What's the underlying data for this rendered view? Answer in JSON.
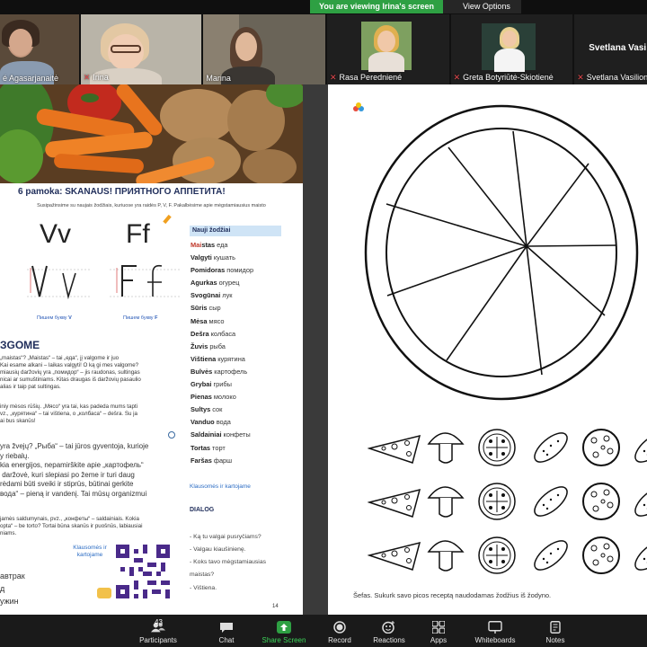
{
  "banner": {
    "viewing": "You are viewing Irina's screen",
    "view_options": "View Options"
  },
  "participants": [
    {
      "name": "é Agasarjanaitė",
      "muted": false
    },
    {
      "name": "Irina",
      "muted": true
    },
    {
      "name": "Marina",
      "muted": false
    },
    {
      "name": "Rasa Peredniené",
      "muted": true
    },
    {
      "name": "Greta Botyriūtė-Skiotienė",
      "muted": true
    },
    {
      "name": "Svetlana Vasilionoi",
      "muted": true
    }
  ],
  "big_name": "Svetlana Vasi",
  "left_page": {
    "title": "6 pamoka: SKANAUS! ПРИЯТНОГО АППЕТИТА!",
    "subtitle": "Susipažinsime su naujais žodžiais, kuriuose yra raidės P, V, F. Pakalbėsime apie mėgstamiausius maisto",
    "letter_v": "Vv",
    "letter_f": "Ff",
    "write_v_caption": "Пишем букву",
    "write_v_letter": "V",
    "write_f_caption": "Пишем букву",
    "write_f_letter": "F",
    "section_title": "ЗGOME",
    "para1": "„maistas“? „Maistas“ – tai „еда“, jį valgome ir juo\nKai esame alkani – laikas valgyti! O ką gi mes valgome?\nmiausių daržovių yra „помидор“ – jis raudonas, sultingas\nnicai ar sumuštiniams. Kitas draugas iš daržovių pasaulio\nalias ir taip pat sultingas.",
    "para2": "iniy mėsos rūšių. „Мясо“ yra tai, kas padeda mums tapti\nvz., „курятина“ – tai vištiena, o „колбаса“ – dešra. Su ja\nai bus skanūs!",
    "para3": "yra žvejų? „Рыба“ – tai jūros gyventoja, kurioje\ny riebalų.\nkia energijos, nepamirškite apie „картофель“\n daržovė, kuri slepiasi po žeme ir turi daug\nrėdami būti sveiki ir stiprūs, būtinai gerkite\nвода“ – pieną ir vandenį. Tai mūsų organizmui",
    "para4": "jamės saldumynais, pvz., „конфеты“ – saldainiais. Kokia\nopta“ – be torto? Tortai būna skanūs ir puošnūs, labiausiai\nniams.",
    "words_ru": [
      "автрак",
      "д",
      "ужин"
    ],
    "qr_label": "Klausomės ir kartojame",
    "page_number": "14",
    "vocab_header": "Nauji žodžiai",
    "vocab": [
      {
        "lt": "Mai",
        "lt2": "stas",
        "ru": "еда"
      },
      {
        "lt": "Val",
        "lt2": "gyti",
        "ru": "кушать"
      },
      {
        "lt": "Pom",
        "lt2": "idoras",
        "ru": "помидор"
      },
      {
        "lt": "Agu",
        "lt2": "rkas",
        "ru": "огурец"
      },
      {
        "lt": "Svo",
        "lt2": "gūnai",
        "ru": "лук"
      },
      {
        "lt": "Sū",
        "lt2": "ris",
        "ru": "сыр"
      },
      {
        "lt": "Mė",
        "lt2": "sa",
        "ru": "мясо"
      },
      {
        "lt": "De",
        "lt2": "šra",
        "ru": "колбаса"
      },
      {
        "lt": "Žu",
        "lt2": "vis",
        "ru": "рыба"
      },
      {
        "lt": "Viš",
        "lt2": "tiena",
        "ru": "курятина"
      },
      {
        "lt": "Bul",
        "lt2": "vės",
        "ru": "картофель"
      },
      {
        "lt": "Gry",
        "lt2": "bai",
        "ru": "грибы"
      },
      {
        "lt": "Pie",
        "lt2": "nas",
        "ru": "молоко"
      },
      {
        "lt": "Sul",
        "lt2": "tys",
        "ru": "сок"
      },
      {
        "lt": "Van",
        "lt2": "duo",
        "ru": "вода"
      },
      {
        "lt": "Sal",
        "lt2": "dainiai",
        "ru": "конфеты"
      },
      {
        "lt": "Tor",
        "lt2": "tas",
        "ru": "торт"
      },
      {
        "lt": "Far",
        "lt2": "šas",
        "ru": "фарш"
      }
    ],
    "vocab_link": "Klausomės ir kartojame",
    "dialog_title": "DIALOG",
    "dialog_lines": [
      "- Ką tu valgai pusryčiams?",
      "- Valgau kiaušinienę.",
      "- Koks tavo mėgstamiausias",
      "maistas?",
      "- Vištiena."
    ]
  },
  "right_page": {
    "caption": "Šefas. Sukurk savo picos receptą naudodamas žodžius iš žodyno."
  },
  "toolbar": {
    "participants_label": "Participants",
    "participants_count": "43",
    "chat_label": "Chat",
    "share_label": "Share Screen",
    "record_label": "Record",
    "reactions_label": "Reactions",
    "apps_label": "Apps",
    "whiteboards_label": "Whiteboards",
    "notes_label": "Notes"
  },
  "colors": {
    "share_green": "#2ea043",
    "link_blue": "#2b6cc4",
    "title_navy": "#1f2d5a",
    "mic_muted": "#e5484d"
  }
}
